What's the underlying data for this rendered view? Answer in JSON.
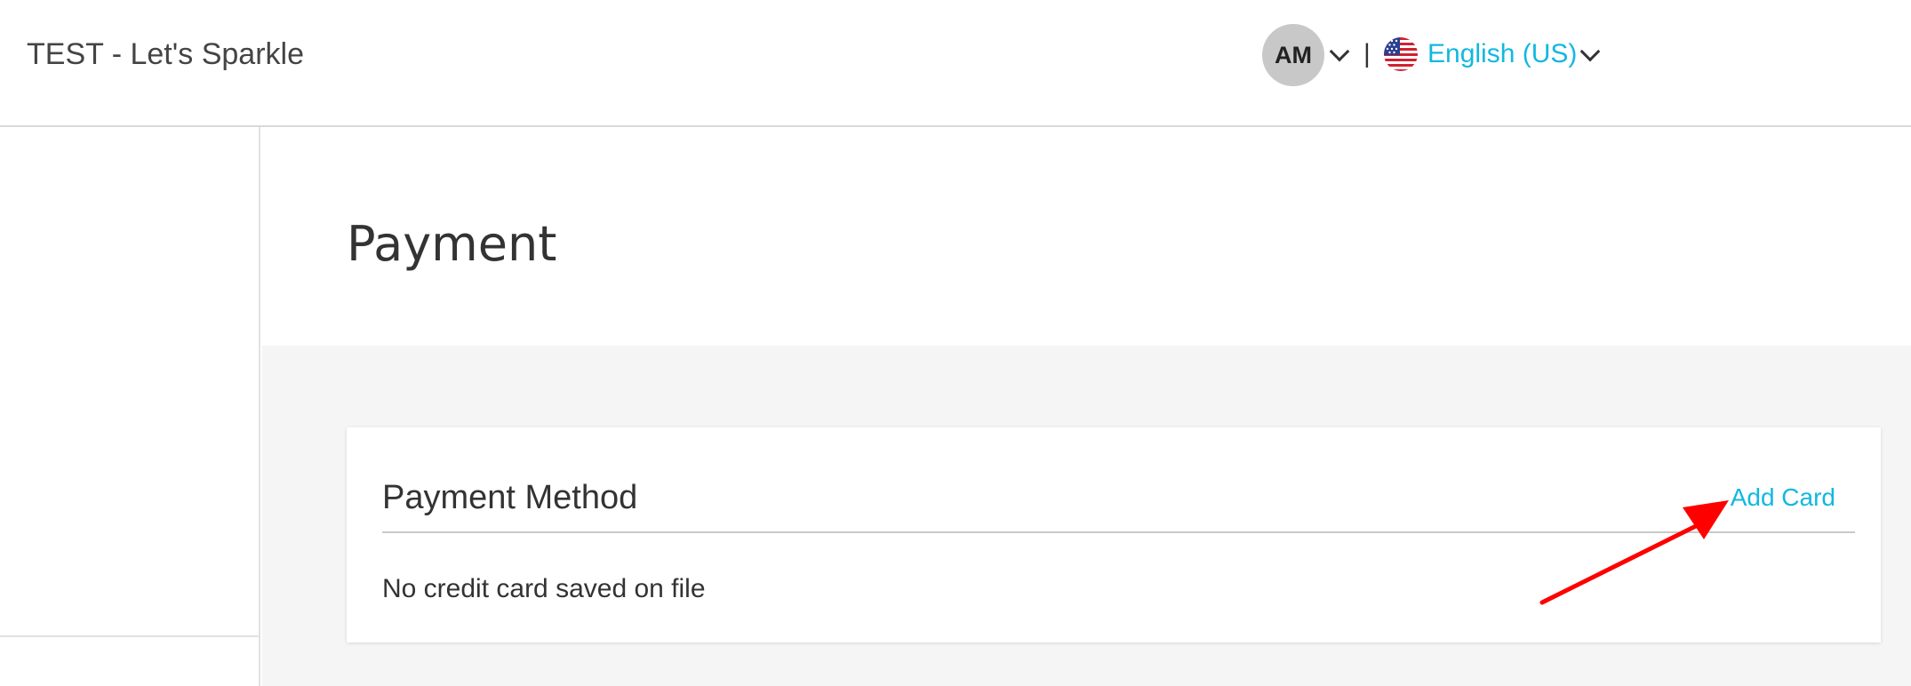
{
  "header": {
    "app_title": "TEST - Let's Sparkle",
    "user_initials": "AM",
    "separator": "|",
    "language": "English (US)"
  },
  "main": {
    "page_title": "Payment",
    "payment_card": {
      "title": "Payment Method",
      "add_card_label": "Add Card",
      "empty_message": "No credit card saved on file"
    }
  },
  "colors": {
    "accent": "#12b8e0",
    "avatar_bg": "#c8c8c8",
    "content_bg": "#f5f5f5",
    "annotation_arrow": "#ff0000"
  },
  "icons": {
    "user_menu": "chevron-down-icon",
    "language_flag": "us-flag-icon",
    "language_menu": "chevron-down-icon"
  }
}
